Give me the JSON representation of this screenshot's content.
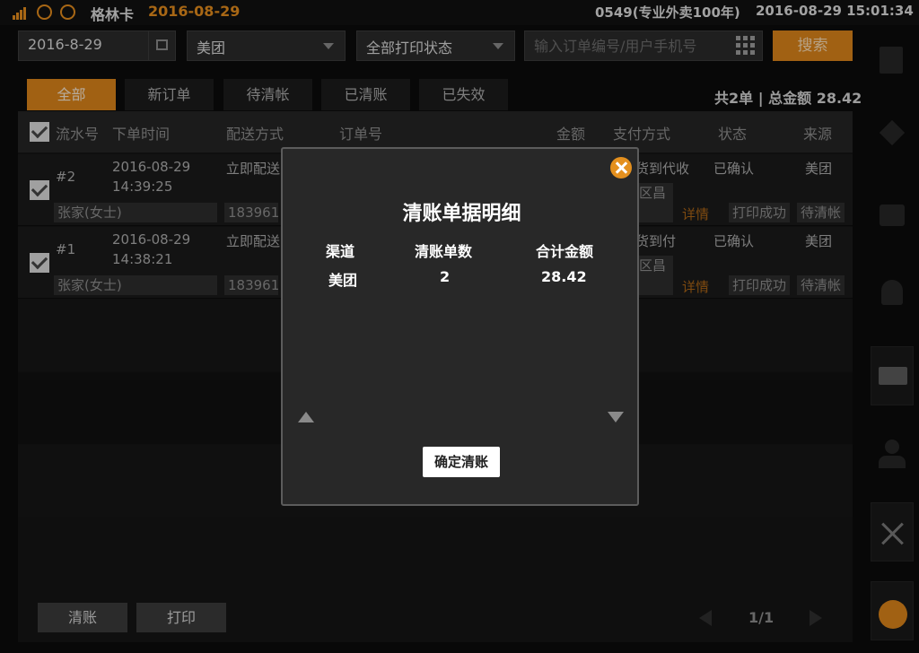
{
  "status_bar": {
    "store_name": "格林卡",
    "date": "2016-08-29",
    "shop_info": "0549(专业外卖100年)",
    "datetime": "2016-08-29 15:01:34"
  },
  "filters": {
    "date": "2016-8-29",
    "platform": "美团",
    "print_status": "全部打印状态",
    "search_placeholder": "输入订单编号/用户手机号",
    "search_label": "搜索"
  },
  "tabs": [
    {
      "label": "全部",
      "active": true
    },
    {
      "label": "新订单",
      "active": false
    },
    {
      "label": "待清帐",
      "active": false
    },
    {
      "label": "已清账",
      "active": false
    },
    {
      "label": "已失效",
      "active": false
    }
  ],
  "summary": "共2单 | 总金额 28.42",
  "table": {
    "columns": [
      "流水号",
      "下单时间",
      "配送方式",
      "订单号",
      "金额",
      "支付方式",
      "状态",
      "来源"
    ],
    "rows": [
      {
        "serial": "#2",
        "date": "2016-08-29",
        "time": "14:39:25",
        "delivery": "立即配送",
        "payment": "货到代收",
        "status": "已确认",
        "source": "美团",
        "customer": "张家(女士)",
        "phone": "183961",
        "address": "区昌",
        "detail": "详情",
        "print": "打印成功",
        "settle": "待清帐"
      },
      {
        "serial": "#1",
        "date": "2016-08-29",
        "time": "14:38:21",
        "delivery": "立即配送",
        "payment": "货到付",
        "status": "已确认",
        "source": "美团",
        "customer": "张家(女士)",
        "phone": "183961",
        "address": "区昌",
        "detail": "详情",
        "print": "打印成功",
        "settle": "待清帐"
      }
    ]
  },
  "footer": {
    "clear_label": "清账",
    "print_label": "打印",
    "page": "1/1"
  },
  "modal": {
    "title": "清账单据明细",
    "headers": [
      "渠道",
      "清账单数",
      "合计金额"
    ],
    "row": {
      "channel": "美团",
      "count": "2",
      "total": "28.42"
    },
    "confirm_label": "确定清账"
  },
  "sidebar_icons": [
    "list-icon",
    "pin-icon",
    "ticket-icon",
    "bell-icon",
    "printer-icon",
    "user-icon",
    "close-icon",
    "chat-icon"
  ],
  "colors": {
    "accent": "#d7821a",
    "background": "#0b0b0b"
  }
}
